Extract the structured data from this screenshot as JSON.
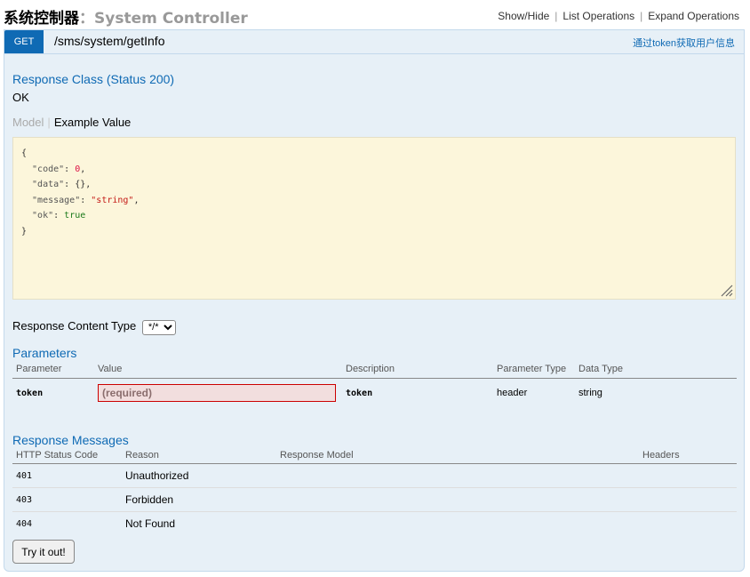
{
  "heading": {
    "title_cn": "系统控制器",
    "title_sep": "：",
    "title_en": "System Controller",
    "links": [
      "Show/Hide",
      "List Operations",
      "Expand Operations"
    ]
  },
  "operation": {
    "method": "GET",
    "path": "/sms/system/getInfo",
    "summary": "通过token获取用户信息"
  },
  "response_class": {
    "title": "Response Class (Status 200)",
    "description": "OK",
    "tab_model": "Model",
    "tab_example": "Example Value",
    "example_lines": {
      "open": "{",
      "code_key": "  \"code\"",
      "code_val": "0",
      "data_key": "  \"data\"",
      "data_val": "{}",
      "message_key": "  \"message\"",
      "message_val": "\"string\"",
      "ok_key": "  \"ok\"",
      "ok_val": "true",
      "close": "}"
    }
  },
  "content_type": {
    "label": "Response Content Type",
    "selected": "*/*"
  },
  "parameters": {
    "title": "Parameters",
    "headers": [
      "Parameter",
      "Value",
      "Description",
      "Parameter Type",
      "Data Type"
    ],
    "rows": [
      {
        "name": "token",
        "placeholder": "(required)",
        "description": "token",
        "param_type": "header",
        "data_type": "string"
      }
    ]
  },
  "response_messages": {
    "title": "Response Messages",
    "headers": [
      "HTTP Status Code",
      "Reason",
      "Response Model",
      "Headers"
    ],
    "rows": [
      {
        "code": "401",
        "reason": "Unauthorized"
      },
      {
        "code": "403",
        "reason": "Forbidden"
      },
      {
        "code": "404",
        "reason": "Not Found"
      }
    ]
  },
  "try_button": "Try it out!"
}
